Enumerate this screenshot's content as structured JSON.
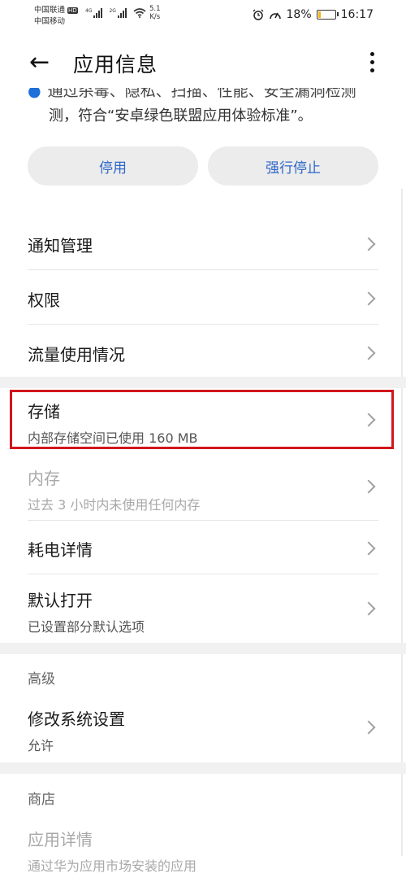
{
  "status_bar": {
    "carrier1": "中国联通",
    "carrier2": "中国移动",
    "hd": "HD",
    "net1": "4G",
    "net2": "2G",
    "speed_value": "5.1",
    "speed_unit": "K/s",
    "battery": "18%",
    "time": "16:17"
  },
  "header": {
    "title": "应用信息"
  },
  "description": {
    "line1": "通过杀毒、隐私、扫描、性能、安全漏洞检测",
    "line2": "测，符合“安卓绿色联盟应用体验标准”。"
  },
  "buttons": {
    "disable": "停用",
    "force_stop": "强行停止"
  },
  "items": [
    {
      "label": "通知管理"
    },
    {
      "label": "权限"
    },
    {
      "label": "流量使用情况"
    },
    {
      "label": "存储",
      "sub": "内部存储空间已使用 160 MB"
    },
    {
      "label": "内存",
      "sub": "过去 3 小时内未使用任何内存"
    },
    {
      "label": "耗电详情"
    },
    {
      "label": "默认打开",
      "sub": "已设置部分默认选项"
    }
  ],
  "advanced": {
    "title": "高级",
    "items": [
      {
        "label": "修改系统设置",
        "sub": "允许"
      }
    ]
  },
  "store": {
    "title": "商店",
    "items": [
      {
        "label": "应用详情",
        "sub": "通过华为应用市场安装的应用"
      }
    ]
  },
  "colors": {
    "accent": "#2f67c9",
    "highlight": "#d0161c",
    "battery": "#f2b51b"
  }
}
